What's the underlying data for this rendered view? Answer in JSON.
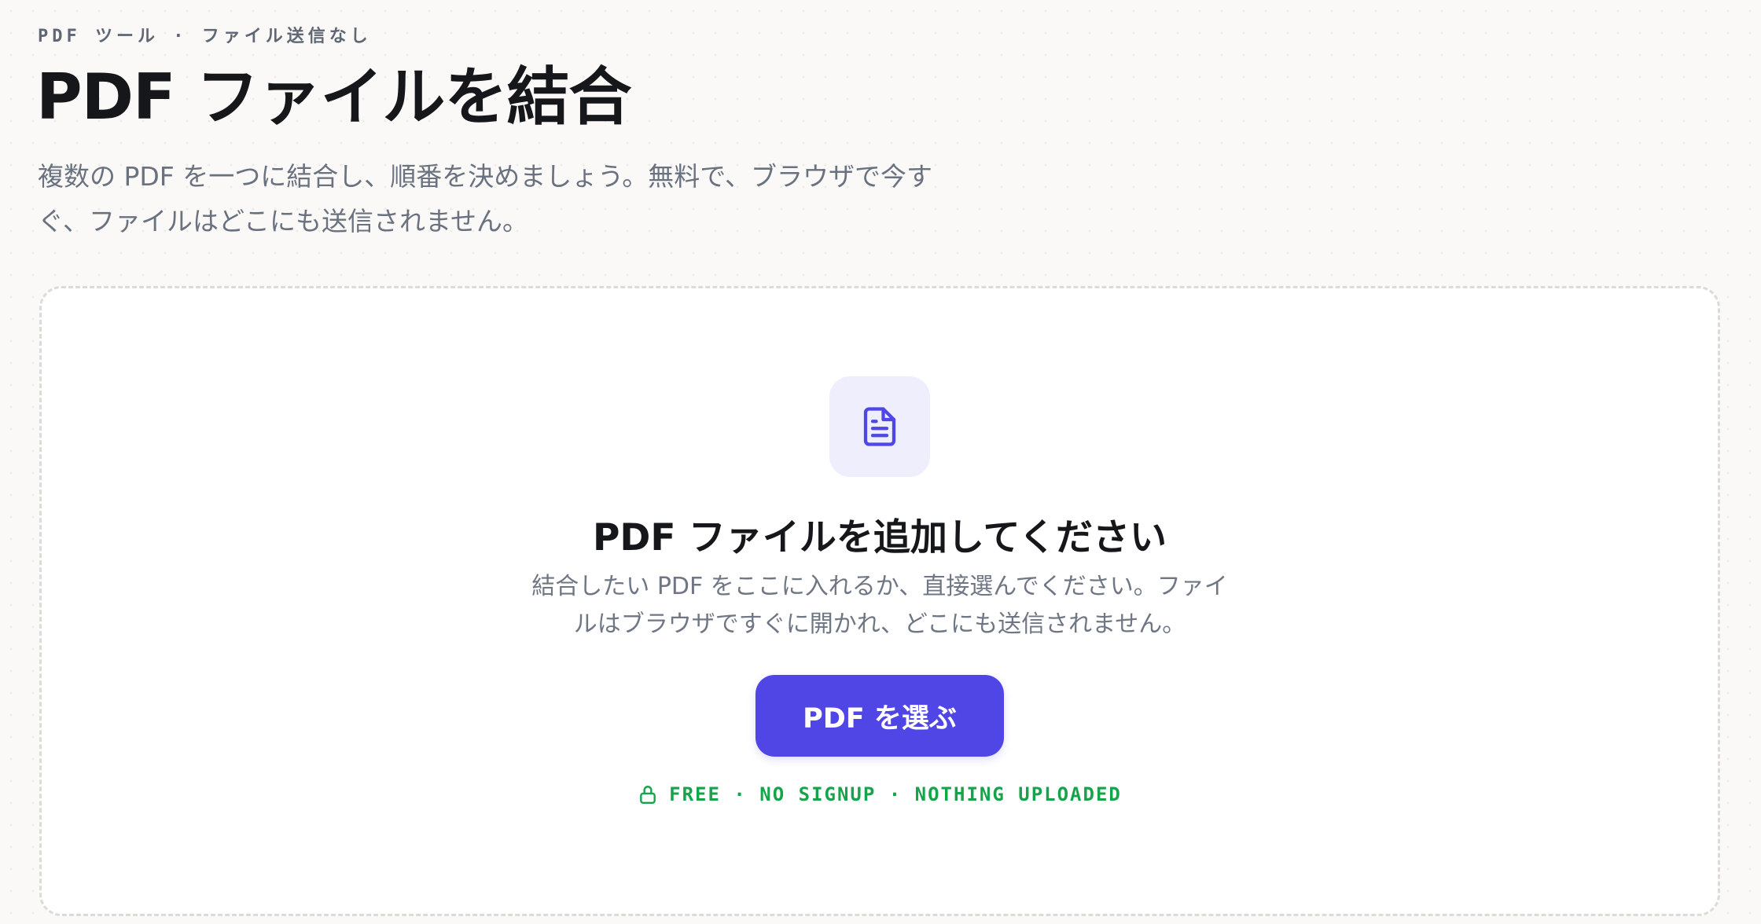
{
  "header": {
    "eyebrow": "PDF ツール · ファイル送信なし",
    "title": "PDF ファイルを結合",
    "subtitle": "複数の PDF を一つに結合し、順番を決めましょう。無料で、ブラウザで今すぐ、ファイルはどこにも送信されません。"
  },
  "dropzone": {
    "icon": "document-icon",
    "title": "PDF ファイルを追加してください",
    "description": "結合したい PDF をここに入れるか、直接選んでください。ファイルはブラウザですぐに開かれ、どこにも送信されません。",
    "button_label": "PDF を選ぶ",
    "trust_icon": "lock-icon",
    "trust_text": "FREE · NO SIGNUP · NOTHING UPLOADED"
  },
  "colors": {
    "accent": "#4f46e5",
    "accent_soft": "#eeeefd",
    "trust_green": "#16a34a",
    "muted_text": "#6a7280",
    "heading_text": "#16171b"
  }
}
